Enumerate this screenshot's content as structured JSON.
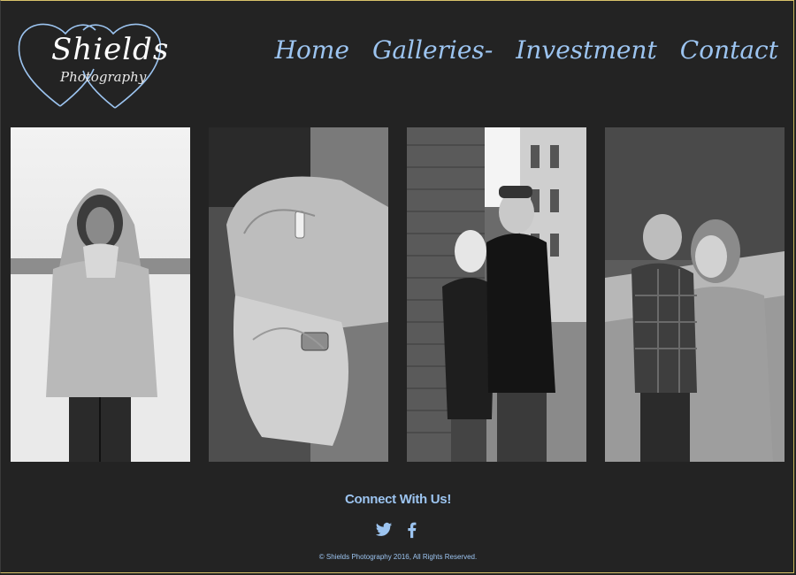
{
  "logo": {
    "title": "Shields",
    "subtitle": "Photography"
  },
  "nav": {
    "items": [
      {
        "label": "Home"
      },
      {
        "label": "Galleries"
      },
      {
        "label": "Investment"
      },
      {
        "label": "Contact"
      }
    ],
    "galleries_suffix": "-"
  },
  "gallery": {
    "photos": [
      {
        "subject": "girl-in-hoodie-snow"
      },
      {
        "subject": "hands-with-rings"
      },
      {
        "subject": "couple-brick-alley"
      },
      {
        "subject": "mother-and-child"
      }
    ]
  },
  "footer": {
    "connect_label": "Connect With Us!",
    "social": [
      {
        "icon": "twitter-icon"
      },
      {
        "icon": "facebook-icon"
      }
    ],
    "copyright": "© Shields Photography 2016, All Rights Reserved."
  },
  "colors": {
    "background": "#232323",
    "accent": "#9cc4f0"
  }
}
